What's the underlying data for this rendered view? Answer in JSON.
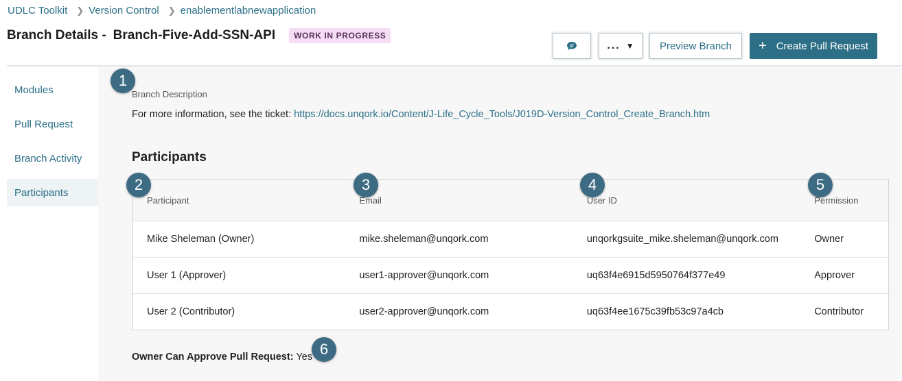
{
  "breadcrumb": [
    "UDLC Toolkit",
    "Version Control",
    "enablementlabnewapplication"
  ],
  "header": {
    "title_prefix": "Branch Details -",
    "branch_name": "Branch-Five-Add-SSN-API",
    "status": "WORK IN PROGRESS"
  },
  "toolbar": {
    "comment_icon": "comment-icon",
    "more_label": "...",
    "preview_label": "Preview Branch",
    "create_pr_label": "Create Pull Request"
  },
  "sidebar": {
    "items": [
      {
        "label": "Modules"
      },
      {
        "label": "Pull Request"
      },
      {
        "label": "Branch Activity"
      },
      {
        "label": "Participants"
      }
    ],
    "active": "Participants"
  },
  "description": {
    "label": "Branch Description",
    "text": "For more information, see the ticket: ",
    "link": "https://docs.unqork.io/Content/J-Life_Cycle_Tools/J019D-Version_Control_Create_Branch.htm"
  },
  "participants": {
    "title": "Participants",
    "columns": [
      "Participant",
      "Email",
      "User ID",
      "Permission"
    ],
    "rows": [
      [
        "Mike Sheleman (Owner)",
        "mike.sheleman@unqork.com",
        "unqorkgsuite_mike.sheleman@unqork.com",
        "Owner"
      ],
      [
        "User 1 (Approver)",
        "user1-approver@unqork.com",
        "uq63f4e6915d5950764f377e49",
        "Approver"
      ],
      [
        "User 2 (Contributor)",
        "user2-approver@unqork.com",
        "uq63f4ee1675c39fb53c97a4cb",
        "Contributor"
      ]
    ]
  },
  "owner_approve": {
    "label": "Owner Can Approve Pull Request:",
    "value": "Yes"
  },
  "markers": [
    "1",
    "2",
    "3",
    "4",
    "5",
    "6"
  ],
  "colors": {
    "accent": "#2d6f86",
    "marker": "#3c6b83",
    "badge_bg": "#f5ddf5"
  }
}
